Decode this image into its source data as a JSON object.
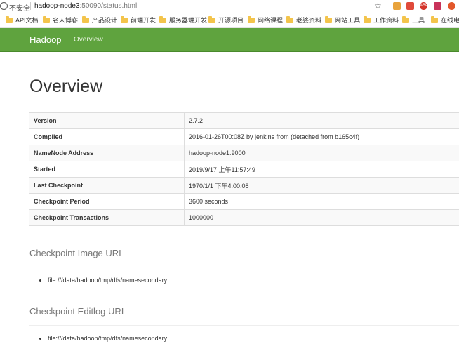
{
  "browser": {
    "secure_label": "不安全",
    "url_host": "hadoop-node3",
    "url_rest": ":50090/status.html",
    "bookmarks": [
      "API文档",
      "名人博客",
      "产品设计",
      "前端开发",
      "服务器端开发",
      "开源项目",
      "网络课程",
      "老婆资料",
      "网站工具",
      "工作资料",
      "工具",
      "在线电子"
    ]
  },
  "navbar": {
    "brand": "Hadoop",
    "link": "Overview"
  },
  "page": {
    "title": "Overview"
  },
  "overview": [
    {
      "key": "Version",
      "value": "2.7.2"
    },
    {
      "key": "Compiled",
      "value": "2016-01-26T00:08Z by jenkins from (detached from b165c4f)"
    },
    {
      "key": "NameNode Address",
      "value": "hadoop-node1:9000"
    },
    {
      "key": "Started",
      "value": "2019/9/17 上午11:57:49"
    },
    {
      "key": "Last Checkpoint",
      "value": "1970/1/1 下午4:00:08"
    },
    {
      "key": "Checkpoint Period",
      "value": "3600 seconds"
    },
    {
      "key": "Checkpoint Transactions",
      "value": "1000000"
    }
  ],
  "image_uri": {
    "title": "Checkpoint Image URI",
    "items": [
      "file:///data/hadoop/tmp/dfs/namesecondary"
    ]
  },
  "editlog_uri": {
    "title": "Checkpoint Editlog URI",
    "items": [
      "file:///data/hadoop/tmp/dfs/namesecondary"
    ]
  }
}
